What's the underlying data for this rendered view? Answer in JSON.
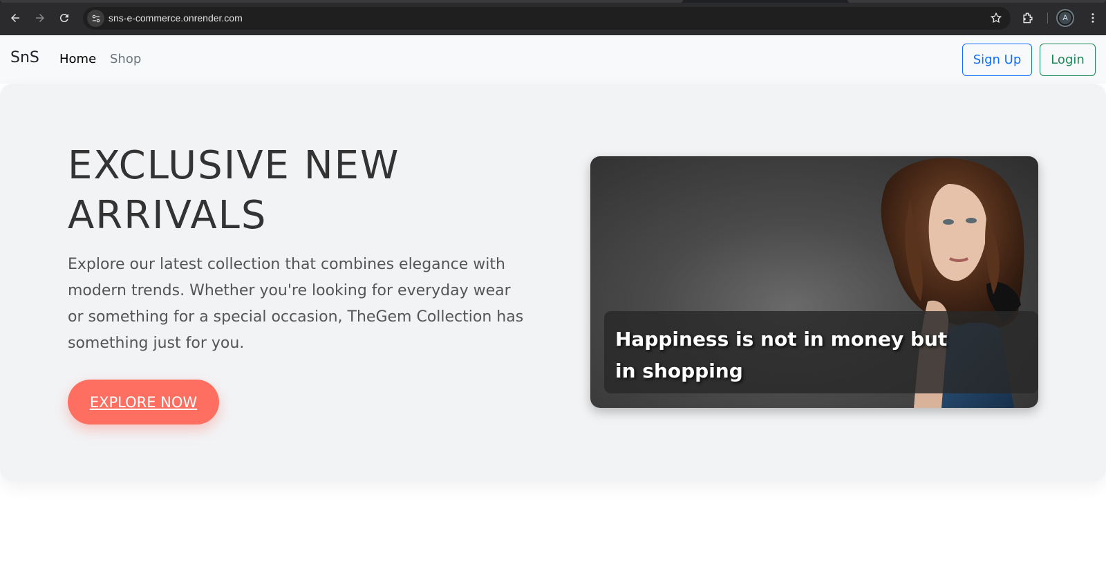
{
  "browser": {
    "url": "sns-e-commerce.onrender.com",
    "profile_initial": "A"
  },
  "navbar": {
    "brand": "SnS",
    "links": [
      {
        "label": "Home"
      },
      {
        "label": "Shop"
      }
    ],
    "signup_label": "Sign Up",
    "login_label": "Login"
  },
  "hero": {
    "title": "EXCLUSIVE NEW ARRIVALS",
    "description": "Explore our latest collection that combines elegance with modern trends. Whether you're looking for everyday wear or something for a special occasion, TheGem Collection has something just for you.",
    "cta_label": "EXPLORE NOW",
    "card_caption": "Happiness is not in money but in shopping"
  },
  "colors": {
    "cta": "#ff6f61",
    "signup": "#0d6efd",
    "login": "#198754"
  }
}
